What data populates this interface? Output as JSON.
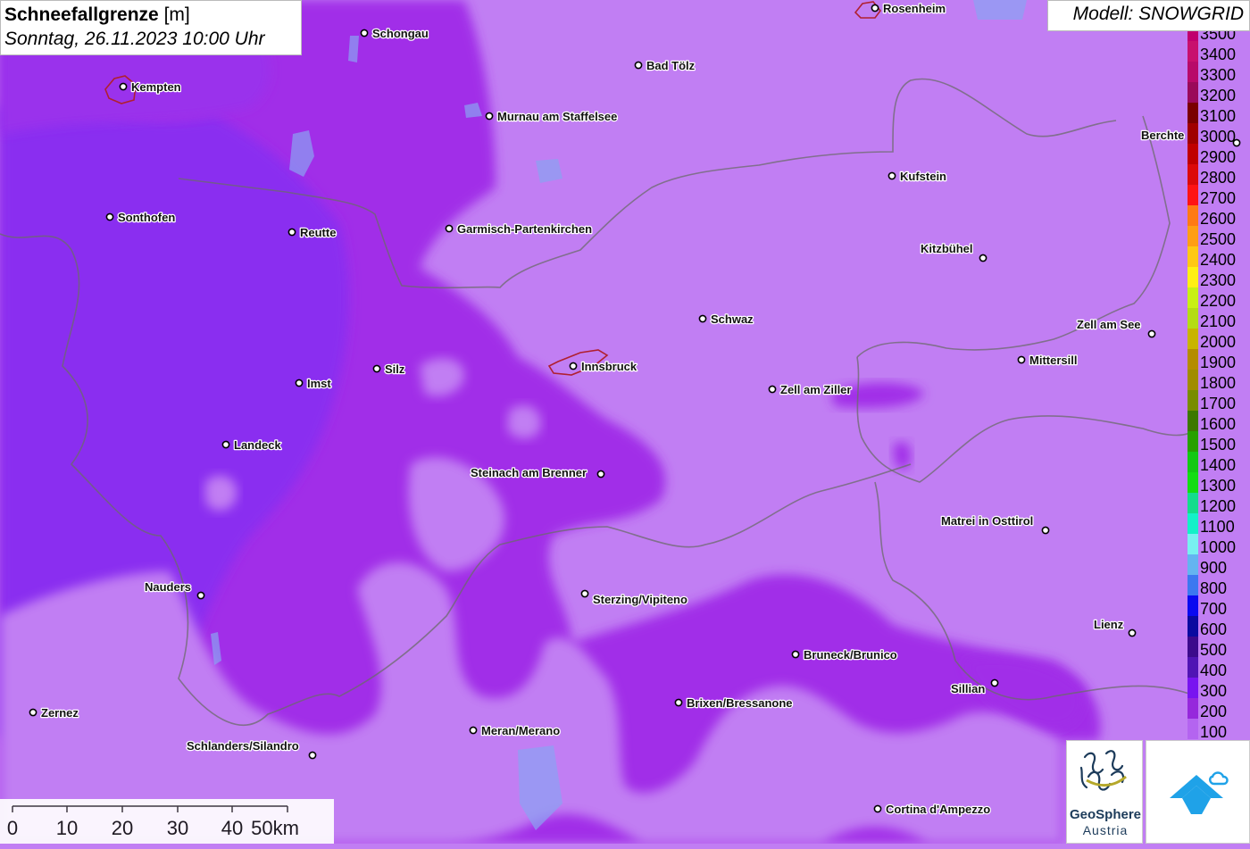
{
  "title": {
    "name": "Schneefallgrenze",
    "unit": "[m]",
    "datetime": "Sonntag, 26.11.2023 10:00 Uhr"
  },
  "model": "Modell: SNOWGRID",
  "colors": {
    "light_purple": "#c17ef3",
    "mid_purple": "#a12fe8",
    "deep_violet": "#8a2df0"
  },
  "cities": [
    {
      "name": "Rosenheim"
    },
    {
      "name": "Schongau"
    },
    {
      "name": "Bad Tölz"
    },
    {
      "name": "Kempten"
    },
    {
      "name": "Murnau am Staffelsee"
    },
    {
      "name": "Berchte"
    },
    {
      "name": "Kufstein"
    },
    {
      "name": "Sonthofen"
    },
    {
      "name": "Reutte"
    },
    {
      "name": "Garmisch-Partenkirchen"
    },
    {
      "name": "Kitzbühel"
    },
    {
      "name": "Schwaz"
    },
    {
      "name": "Zell am See"
    },
    {
      "name": "Mittersill"
    },
    {
      "name": "Silz"
    },
    {
      "name": "Innsbruck"
    },
    {
      "name": "Imst"
    },
    {
      "name": "Zell am Ziller"
    },
    {
      "name": "Landeck"
    },
    {
      "name": "Steinach am Brenner"
    },
    {
      "name": "Matrei in Osttirol"
    },
    {
      "name": "Nauders"
    },
    {
      "name": "Sterzing/Vipiteno"
    },
    {
      "name": "Lienz"
    },
    {
      "name": "Bruneck/Brunico"
    },
    {
      "name": "Sillian"
    },
    {
      "name": "Brixen/Bressanone"
    },
    {
      "name": "Zernez"
    },
    {
      "name": "Meran/Merano"
    },
    {
      "name": "Schlanders/Silandro"
    },
    {
      "name": "Cortina d'Ampezzo"
    }
  ],
  "legend": [
    {
      "label": "3500",
      "color": "#c0006e"
    },
    {
      "label": "3400",
      "color": "#c8106e"
    },
    {
      "label": "3300",
      "color": "#b80a6a"
    },
    {
      "label": "3200",
      "color": "#9a0a5a"
    },
    {
      "label": "3100",
      "color": "#7a0000"
    },
    {
      "label": "3000",
      "color": "#a00000"
    },
    {
      "label": "2900",
      "color": "#c00000"
    },
    {
      "label": "2800",
      "color": "#dc0a0a"
    },
    {
      "label": "2700",
      "color": "#ff1414"
    },
    {
      "label": "2600",
      "color": "#ff7a14"
    },
    {
      "label": "2500",
      "color": "#ff9e14"
    },
    {
      "label": "2400",
      "color": "#ffc814"
    },
    {
      "label": "2300",
      "color": "#fff014"
    },
    {
      "label": "2200",
      "color": "#c8f014"
    },
    {
      "label": "2100",
      "color": "#b4dc14"
    },
    {
      "label": "2000",
      "color": "#c8b400"
    },
    {
      "label": "1900",
      "color": "#b48c00"
    },
    {
      "label": "1800",
      "color": "#a08c00"
    },
    {
      "label": "1700",
      "color": "#788c00"
    },
    {
      "label": "1600",
      "color": "#3c7800"
    },
    {
      "label": "1500",
      "color": "#28a000"
    },
    {
      "label": "1400",
      "color": "#14c814"
    },
    {
      "label": "1300",
      "color": "#14dc14"
    },
    {
      "label": "1200",
      "color": "#14dc8c"
    },
    {
      "label": "1100",
      "color": "#14f0c8"
    },
    {
      "label": "1000",
      "color": "#78f0f0"
    },
    {
      "label": "900",
      "color": "#64b4f0"
    },
    {
      "label": "800",
      "color": "#3c78f0"
    },
    {
      "label": "700",
      "color": "#0a0af0"
    },
    {
      "label": "600",
      "color": "#0a0aa0"
    },
    {
      "label": "500",
      "color": "#3c0a8c"
    },
    {
      "label": "400",
      "color": "#5014b4"
    },
    {
      "label": "300",
      "color": "#7814f0"
    },
    {
      "label": "200",
      "color": "#9628dc"
    },
    {
      "label": "100",
      "color": "#b464f0"
    }
  ],
  "scale": {
    "ticks": [
      "0",
      "10",
      "20",
      "30",
      "40",
      "50km"
    ]
  },
  "logos": {
    "left_name": "GeoSphere",
    "left_sub": "Austria"
  }
}
